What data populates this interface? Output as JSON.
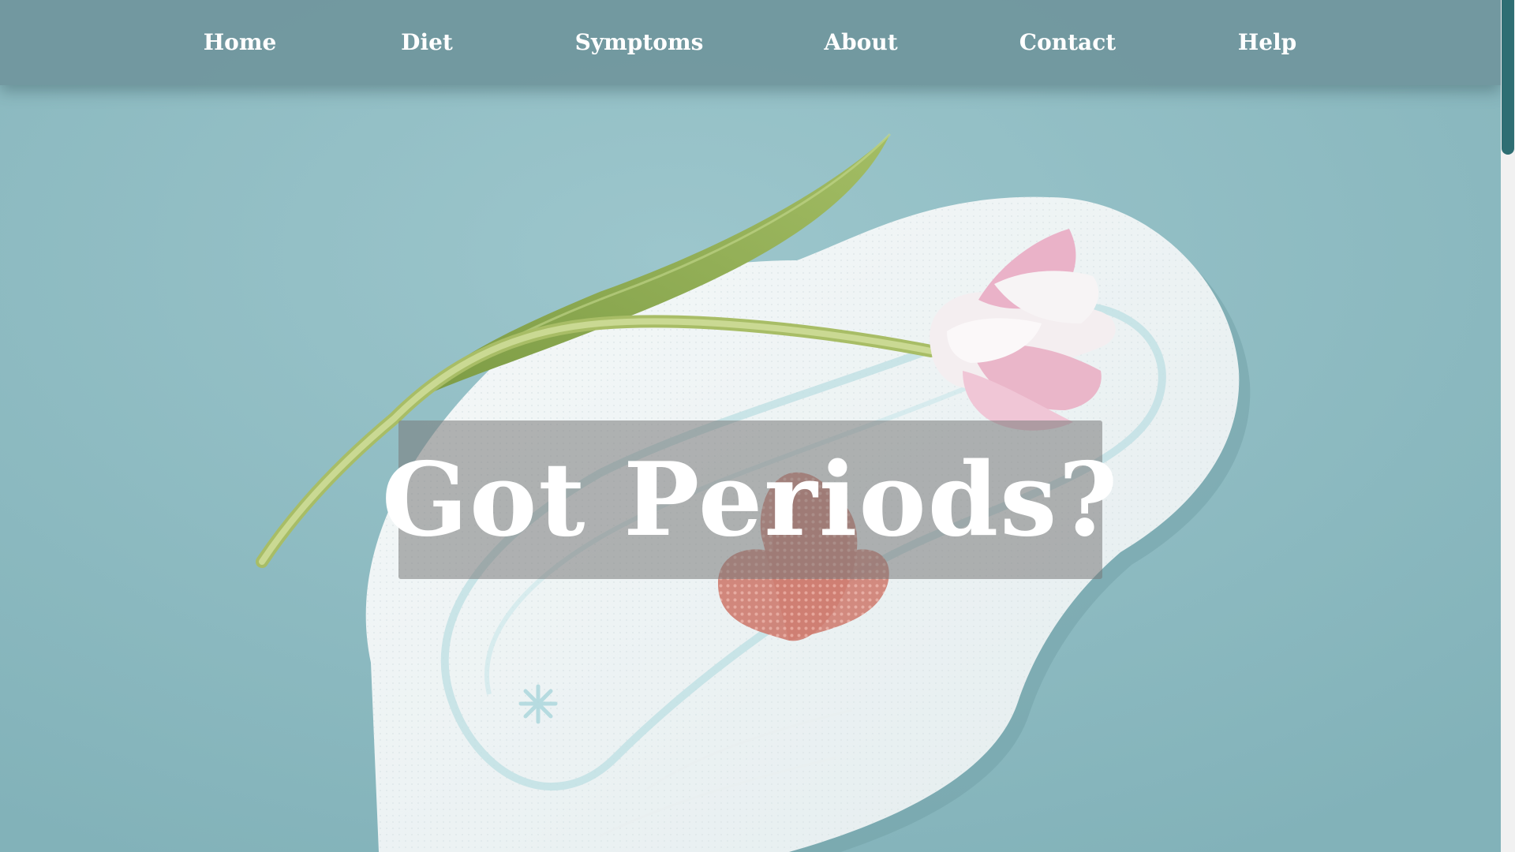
{
  "nav": {
    "items": [
      {
        "label": "Home"
      },
      {
        "label": "Diet"
      },
      {
        "label": "Symptoms"
      },
      {
        "label": "About"
      },
      {
        "label": "Contact"
      },
      {
        "label": "Help"
      }
    ]
  },
  "hero": {
    "headline": "Got Periods?",
    "image": {
      "subject": "sanitary pad with a heart-shaped stain and a pink tulip on a light teal background"
    }
  },
  "colors": {
    "nav_background": "#70969d",
    "background": "#8fbcc3",
    "scrollbar_thumb": "#2e6e73",
    "text": "#ffffff"
  }
}
